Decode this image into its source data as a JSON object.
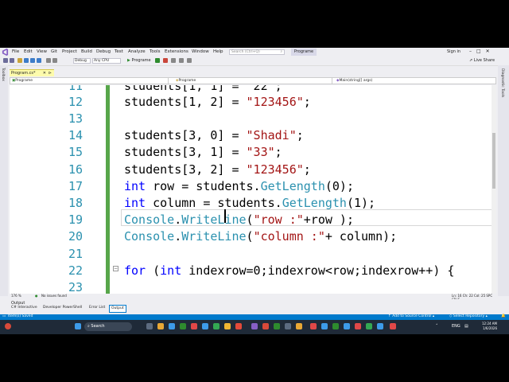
{
  "menubar": {
    "items": [
      "File",
      "Edit",
      "View",
      "Git",
      "Project",
      "Build",
      "Debug",
      "Test",
      "Analyze",
      "Tools",
      "Extensions",
      "Window",
      "Help"
    ],
    "search_placeholder": "Search (Ctrl+Q)",
    "solution_name": "Programe",
    "sign_in": "Sign in"
  },
  "toolbar": {
    "config": "Debug",
    "platform": "Any CPU",
    "start_label": "Programe",
    "live_share": "Live Share"
  },
  "side": {
    "toolbox": "Toolbox",
    "diagnostic": "Diagnostic Tools"
  },
  "tabs": {
    "active": "Program.cs*"
  },
  "nav": {
    "project": "Programe",
    "class": "Programe",
    "member": "Main(string[] args)"
  },
  "editor": {
    "lines": [
      {
        "n": "11",
        "text": "students[1, 1] = \"22\";"
      },
      {
        "n": "12",
        "text": "students[1, 2] = \"123456\";"
      },
      {
        "n": "13",
        "text": ""
      },
      {
        "n": "14",
        "text": "students[3, 0] = \"Shadi\";"
      },
      {
        "n": "15",
        "text": "students[3, 1] = \"33\";"
      },
      {
        "n": "16",
        "text": "students[3, 2] = \"123456\";"
      },
      {
        "n": "17",
        "text": "int row = students.GetLength(0);"
      },
      {
        "n": "18",
        "text": "int column = students.GetLength(1);"
      },
      {
        "n": "19",
        "text": "Console.WriteLine(\"row :\"+row );"
      },
      {
        "n": "20",
        "text": "Console.WriteLine(\"column :\"+ column);"
      },
      {
        "n": "21",
        "text": ""
      },
      {
        "n": "22",
        "text": "for (int indexrow=0;indexrow<row;indexrow++) {"
      },
      {
        "n": "23",
        "text": ""
      }
    ],
    "zoom": "176 %",
    "issues": "No issues found",
    "position": "Ln: 16   Ch: 22   Col: 25   SPC   CRLF"
  },
  "output": {
    "title": "Output",
    "tabs": [
      "C# Interactive",
      "Developer PowerShell",
      "Error List",
      "Output"
    ]
  },
  "statusbar": {
    "left": "Item(s) Saved",
    "source_control": "Add to Source Control",
    "repository": "Select Repository"
  },
  "taskbar": {
    "search": "Search",
    "lang": "ENG",
    "time": "12:24 AM",
    "date": "1/6/2026"
  },
  "colors": {
    "accent": "#007acc",
    "tab_active": "#fdfbac",
    "gutter_changed": "#57a64a"
  }
}
